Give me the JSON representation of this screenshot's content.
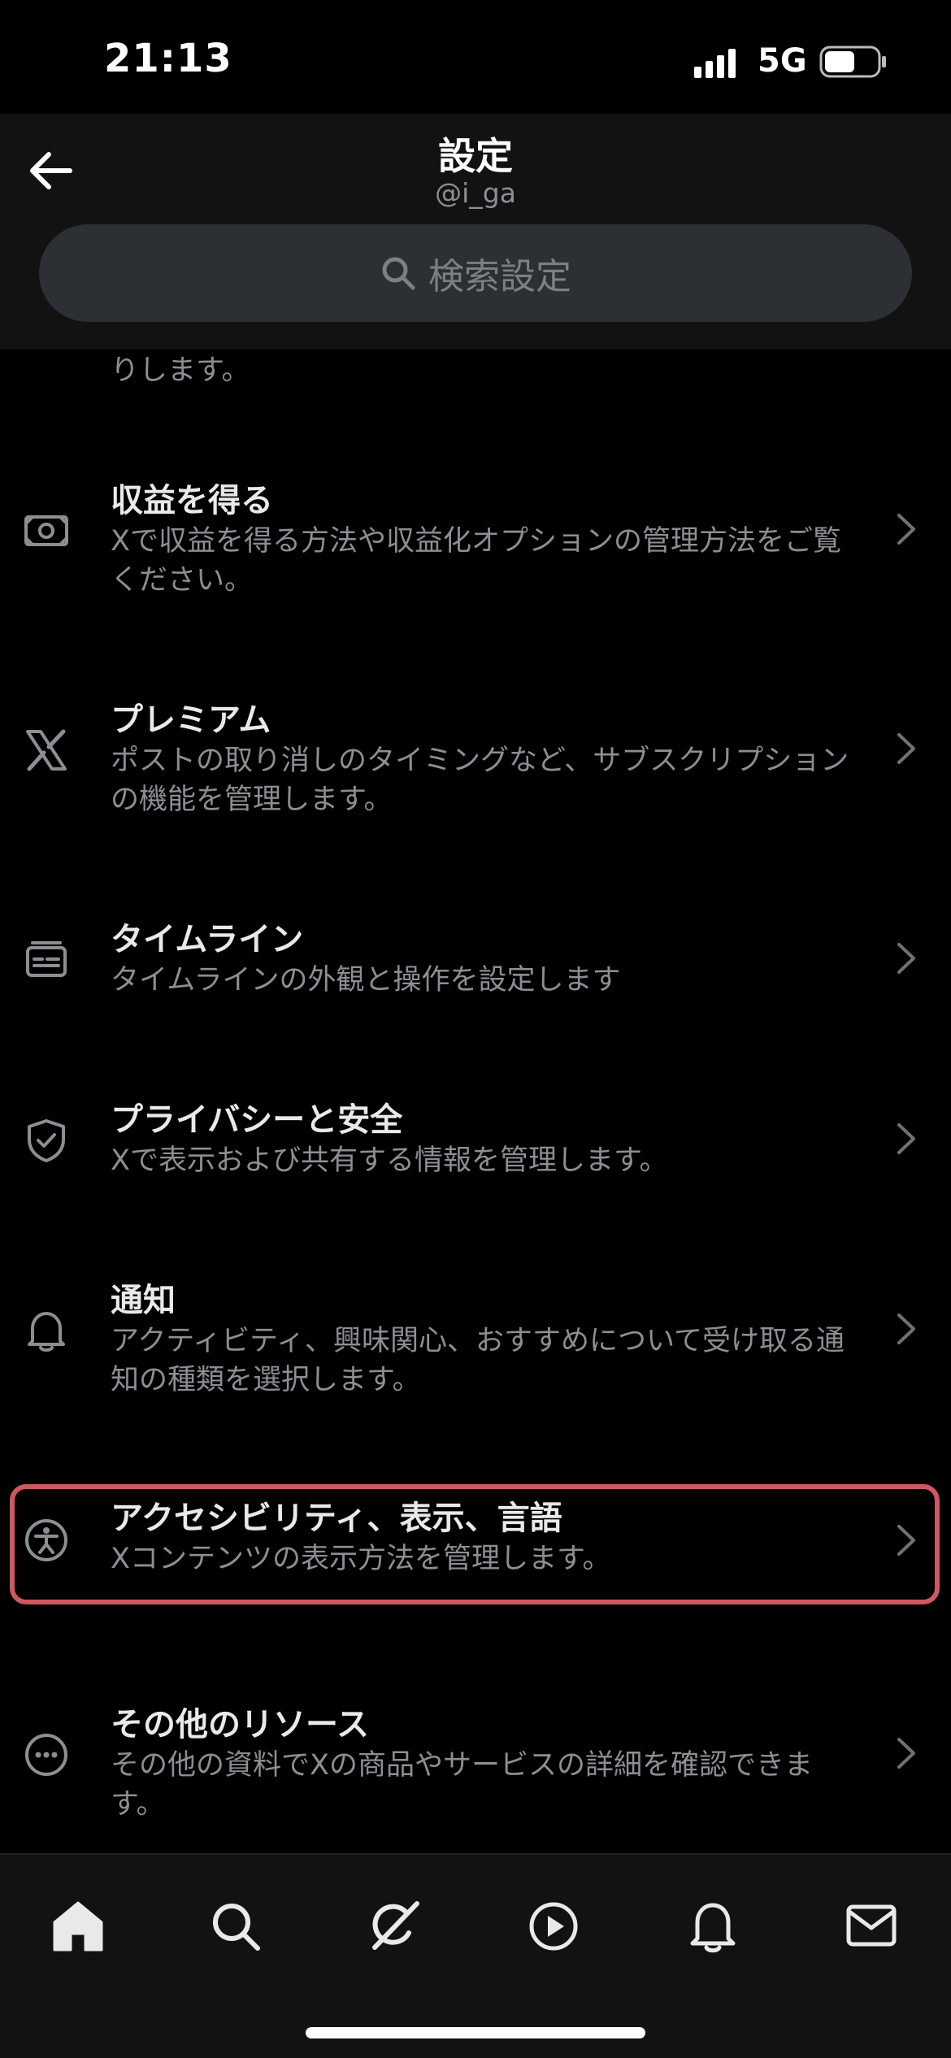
{
  "status_bar": {
    "time": "21:13",
    "network": "5G"
  },
  "header": {
    "title": "設定",
    "handle": "@i_ga",
    "back_icon": "arrow-left-icon"
  },
  "search": {
    "placeholder": "検索設定",
    "icon": "search-icon"
  },
  "list": {
    "partial_text": "りします。",
    "items": [
      {
        "title": "収益を得る",
        "desc": "Xで収益を得る方法や収益化オプションの管理方法をご覧ください。",
        "icon": "money-icon"
      },
      {
        "title": "プレミアム",
        "desc": "ポストの取り消しのタイミングなど、サブスクリプションの機能を管理します。",
        "icon": "x-logo-icon"
      },
      {
        "title": "タイムライン",
        "desc": "タイムラインの外観と操作を設定します",
        "icon": "timeline-icon"
      },
      {
        "title": "プライバシーと安全",
        "desc": "Xで表示および共有する情報を管理します。",
        "icon": "shield-icon"
      },
      {
        "title": "通知",
        "desc": "アクティビティ、興味関心、おすすめについて受け取る通知の種類を選択します。",
        "icon": "bell-icon"
      },
      {
        "title": "アクセシビリティ、表示、言語",
        "desc": "Xコンテンツの表示方法を管理します。",
        "icon": "accessibility-icon",
        "highlighted": true
      },
      {
        "title": "その他のリソース",
        "desc": "その他の資料でXの商品やサービスの詳細を確認できます。",
        "icon": "more-circle-icon"
      }
    ]
  },
  "highlight_color": "#cf5860",
  "bottom_nav": {
    "items": [
      "home-icon",
      "search-icon",
      "grok-icon",
      "play-icon",
      "bell-icon",
      "mail-icon"
    ]
  }
}
